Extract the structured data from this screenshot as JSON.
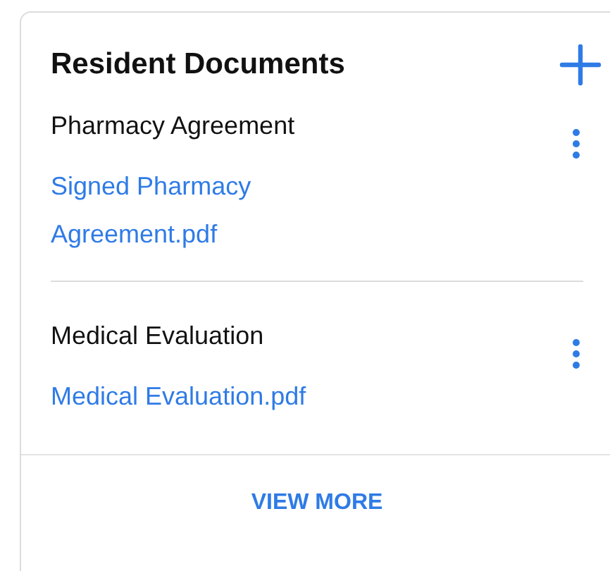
{
  "card": {
    "title": "Resident Documents",
    "documents": [
      {
        "name": "Pharmacy Agreement",
        "file": "Signed Pharmacy Agreement.pdf"
      },
      {
        "name": "Medical Evaluation",
        "file": "Medical Evaluation.pdf"
      }
    ],
    "footer_link": "VIEW MORE"
  }
}
